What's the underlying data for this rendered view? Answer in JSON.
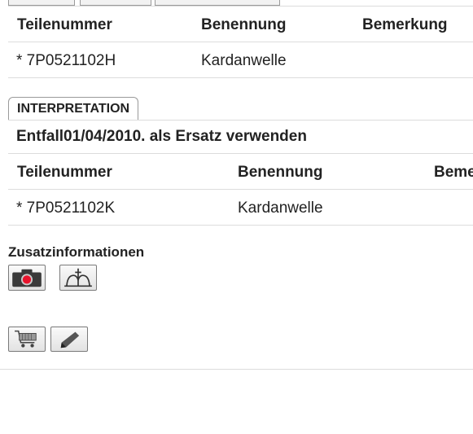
{
  "table1": {
    "headers": [
      "Teilenummer",
      "Benennung",
      "Bemerkung"
    ],
    "row": {
      "part_number": "* 7P0521102H",
      "name": "Kardanwelle"
    }
  },
  "interpretation": {
    "tab_label": "INTERPRETATION",
    "note": "Entfall01/04/2010. als Ersatz verwenden"
  },
  "table2": {
    "headers": [
      "Teilenummer",
      "Benennung",
      "Beme"
    ],
    "row": {
      "part_number": "* 7P0521102K",
      "name": "Kardanwelle"
    }
  },
  "additional_info": {
    "title": "Zusatzinformationen",
    "icons": [
      "camera-icon",
      "exploded-view-icon"
    ]
  },
  "actions": {
    "icons": [
      "shopping-cart-icon",
      "pencil-icon"
    ]
  }
}
